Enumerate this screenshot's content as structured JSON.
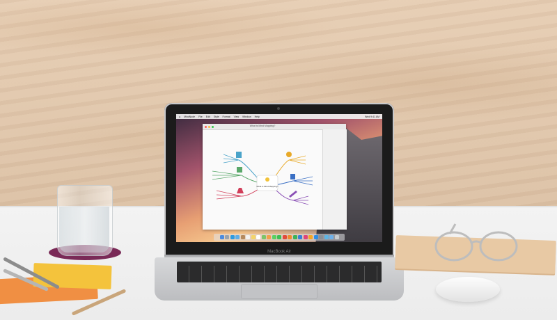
{
  "scene": {
    "laptop_label": "MacBook Air",
    "menubar_items": [
      "MindNode",
      "File",
      "Edit",
      "Style",
      "Format",
      "View",
      "Window",
      "Help"
    ],
    "clock": "Wed 9:41 AM",
    "window_title": "What is Mind Mapping?",
    "central_topic": "What is Mind Mapping?"
  },
  "colors": {
    "wall": "#e3c9ae",
    "desk": "#f0f0f0",
    "coaster": "#7a2a57",
    "book_orange": "#f08f43",
    "book_yellow": "#f4c33c",
    "notebook": "#e8c9a4",
    "laptop_silver": "#c9cacc"
  },
  "mindmap_branches": [
    {
      "color": "#4aa3c9"
    },
    {
      "color": "#5aa86a"
    },
    {
      "color": "#d13e5a"
    },
    {
      "color": "#e8a928"
    },
    {
      "color": "#3a6fc4"
    },
    {
      "color": "#8a4fb5"
    }
  ]
}
